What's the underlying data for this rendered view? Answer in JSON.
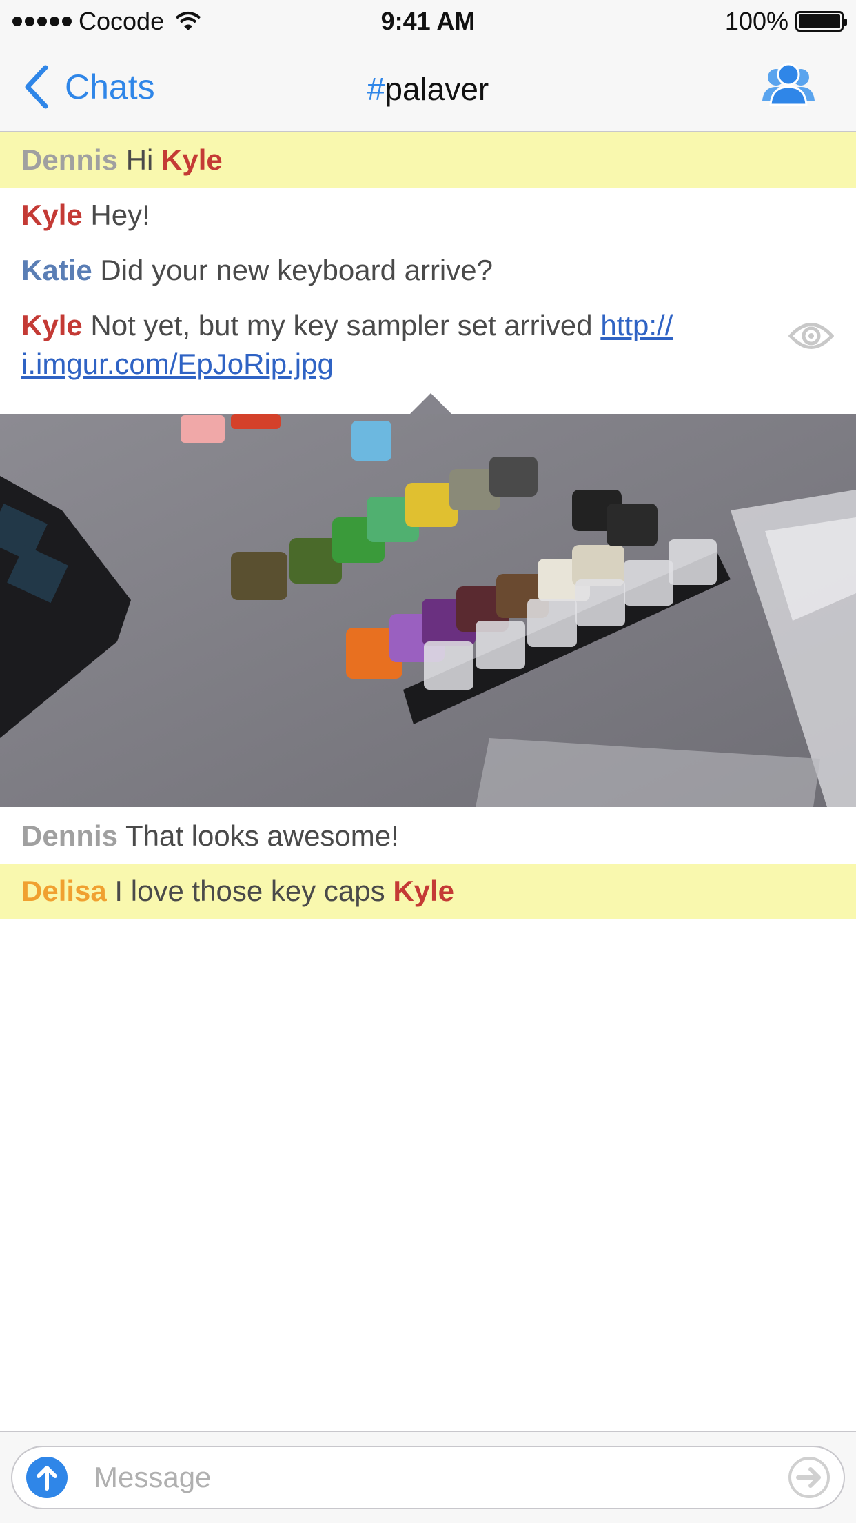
{
  "status_bar": {
    "carrier": "Cocode",
    "time": "9:41 AM",
    "battery": "100%"
  },
  "nav": {
    "back_label": "Chats",
    "title_hash": "#",
    "title": "palaver"
  },
  "messages": [
    {
      "nick": "Dennis",
      "text": "Hi ",
      "mention": "Kyle"
    },
    {
      "nick": "Kyle",
      "text": "Hey!"
    },
    {
      "nick": "Katie",
      "text": "Did your new keyboard arrive?"
    },
    {
      "nick": "Kyle",
      "text": "Not yet, but my key sampler set arrived ",
      "link_line1": "http://",
      "link_line2": "i.imgur.com/EpJoRip.jpg"
    },
    {
      "nick": "Dennis",
      "text": "That looks awesome!"
    },
    {
      "nick": "Delisa",
      "text": "I love those key caps ",
      "mention": "Kyle"
    }
  ],
  "input": {
    "placeholder": "Message"
  },
  "colors": {
    "accent": "#2f86e8",
    "highlight": "#f9f8ae",
    "kyle": "#c43a35",
    "katie": "#5a7eb5",
    "delisa": "#f0a030",
    "dennis": "#a0a0a0"
  }
}
